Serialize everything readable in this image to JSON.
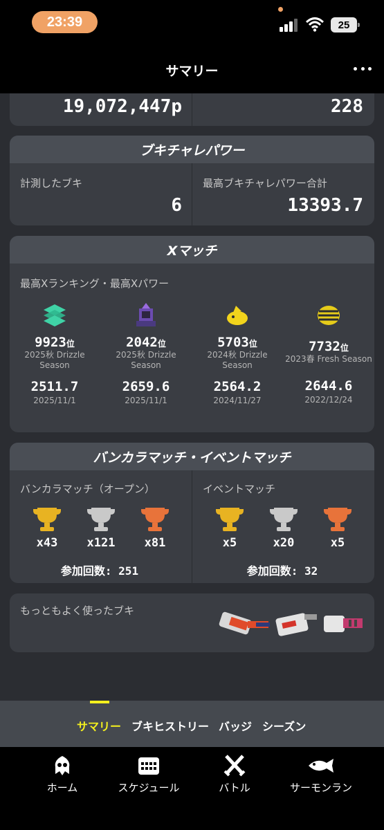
{
  "status": {
    "time": "23:39",
    "battery": "25"
  },
  "header": {
    "title": "サマリー"
  },
  "top_stats": {
    "left_value": "19,072,447p",
    "right_value": "228"
  },
  "buki_power": {
    "title": "ブキチャレパワー",
    "left_label": "計測したブキ",
    "left_value": "6",
    "right_label": "最高ブキチャレパワー合計",
    "right_value": "13393.7"
  },
  "x_match": {
    "title": "Xマッチ",
    "subtitle": "最高Xランキング・最高Xパワー",
    "entries": [
      {
        "icon": "green-stack-icon",
        "rank": "9923",
        "rank_suffix": "位",
        "season_line1": "2025秋 Drizzle",
        "season_line2": "Season",
        "power": "2511.7",
        "date": "2025/11/1"
      },
      {
        "icon": "purple-tower-icon",
        "rank": "2042",
        "rank_suffix": "位",
        "season_line1": "2025秋 Drizzle",
        "season_line2": "Season",
        "power": "2659.6",
        "date": "2025/11/1"
      },
      {
        "icon": "yellow-fish-icon",
        "rank": "5703",
        "rank_suffix": "位",
        "season_line1": "2024秋 Drizzle",
        "season_line2": "Season",
        "power": "2564.2",
        "date": "2024/11/27"
      },
      {
        "icon": "striped-ball-icon",
        "rank": "7732",
        "rank_suffix": "位",
        "season_line1": "2023春 Fresh Season",
        "season_line2": "",
        "power": "2644.6",
        "date": "2022/12/24"
      }
    ]
  },
  "bankara": {
    "title": "バンカラマッチ・イベントマッチ",
    "left_label": "バンカラマッチ（オープン）",
    "left_counts": [
      "x43",
      "x121",
      "x81"
    ],
    "left_total": "参加回数: 251",
    "right_label": "イベントマッチ",
    "right_counts": [
      "x5",
      "x20",
      "x5"
    ],
    "right_total": "参加回数: 32"
  },
  "weapons": {
    "label": "もっともよく使ったブキ"
  },
  "tabs": [
    "サマリー",
    "ブキヒストリー",
    "バッジ",
    "シーズン"
  ],
  "nav": [
    "ホーム",
    "スケジュール",
    "バトル",
    "サーモンラン"
  ],
  "colors": {
    "gold": "#e8b322",
    "silver": "#c9c9c9",
    "bronze": "#e8733a",
    "accent": "#f4f01e"
  }
}
